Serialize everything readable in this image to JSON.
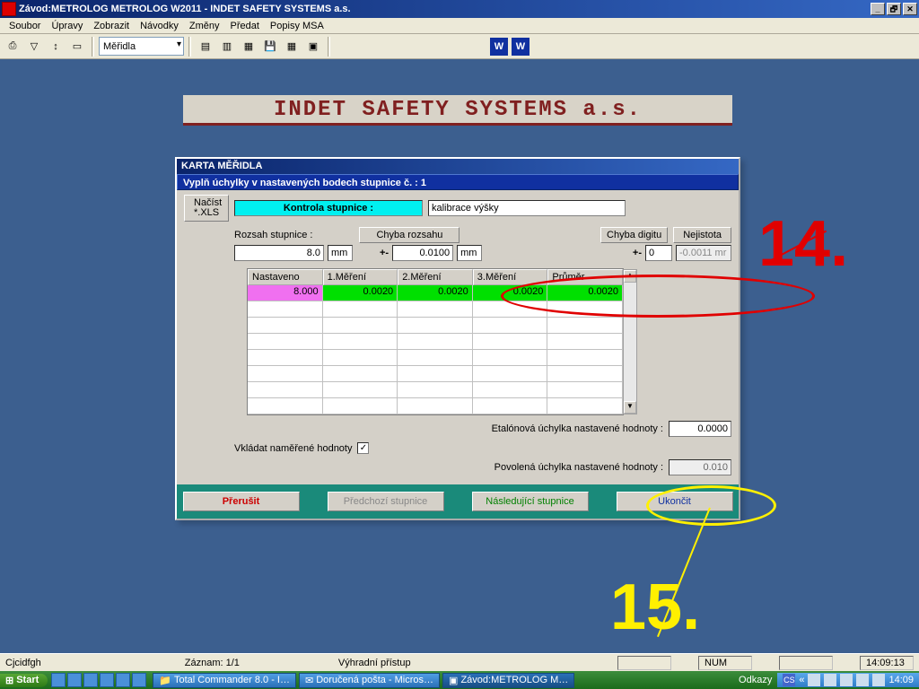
{
  "title": "Závod:METROLOG   METROLOG W2011 - INDET SAFETY SYSTEMS a.s.",
  "menu": [
    "Soubor",
    "Úpravy",
    "Zobrazit",
    "Návodky",
    "Změny",
    "Předat",
    "Popisy MSA"
  ],
  "combo": "Měřidla",
  "banner": "INDET  SAFETY  SYSTEMS  a.s.",
  "dlg": {
    "caption": "KARTA MĚŘIDLA",
    "bluebar": "Vyplň úchylky v nastavených bodech stupnice č. :    1",
    "nacist": "Načíst *.XLS",
    "kontrola_lbl": "Kontrola stupnice :",
    "kontrola_val": "kalibrace výšky",
    "rozsah_lbl": "Rozsah stupnice :",
    "rozsah_val": "8.0",
    "rozsah_unit": "mm",
    "chybarozsahu": "Chyba rozsahu",
    "pm1": "+-",
    "chr_val": "0.0100",
    "chr_unit": "mm",
    "chybadigitu": "Chyba digitu",
    "pm2": "+-",
    "chd_val": "0",
    "nejistota_btn": "Nejistota",
    "nejistota_val": "-0.0011 mr",
    "headers": [
      "Nastaveno",
      "1.Měření",
      "2.Měření",
      "3.Měření",
      "Průměr"
    ],
    "row1": [
      "8.000",
      "0.0020",
      "0.0020",
      "0.0020",
      "0.0020"
    ],
    "etal_lbl": "Etalónová úchylka nastavené hodnoty :",
    "etal_val": "0.0000",
    "vkladat": "Vkládat naměřené hodnoty",
    "pov_lbl": "Povolená úchylka nastavené hodnoty :",
    "pov_val": "0.010",
    "buttons": {
      "prerusit": "Přerušit",
      "predchozi": "Předchozí stupnice",
      "nasledujici": "Následující stupnice",
      "ukoncit": "Ukončit"
    }
  },
  "anno": {
    "n14": "14.",
    "n15": "15."
  },
  "status": {
    "left": "Cjcidfgh",
    "zaznam": "Záznam: 1/1",
    "pristup": "Výhradní přístup",
    "num": "NUM",
    "time": "14:09:13"
  },
  "taskbar": {
    "start": "Start",
    "tasks": [
      "Total Commander 8.0 - I…",
      "Doručená pošta - Micros…",
      "Závod:METROLOG  M…"
    ],
    "odkazy": "Odkazy",
    "lang": "CS",
    "time": "14:09"
  }
}
